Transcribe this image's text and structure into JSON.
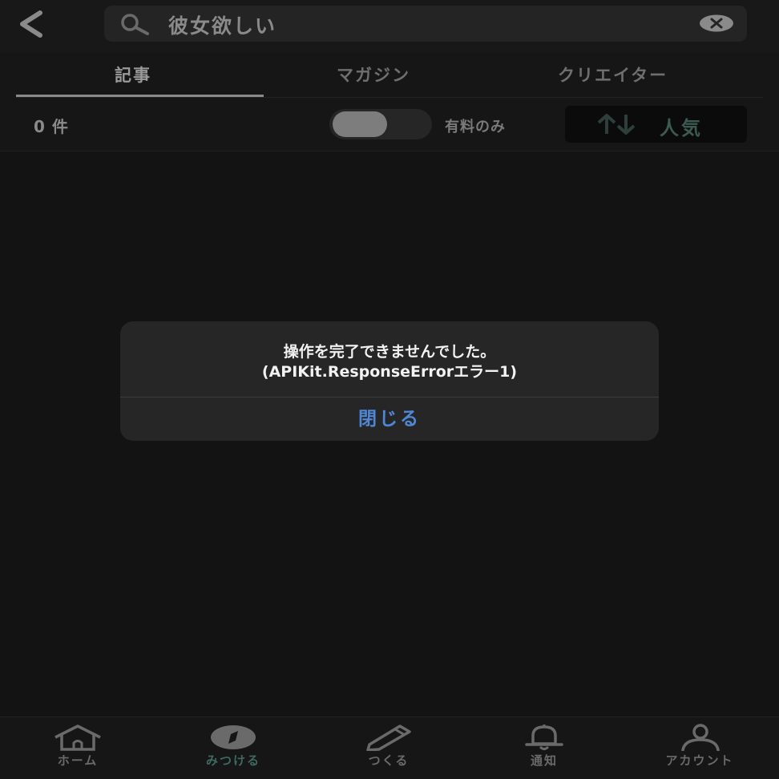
{
  "search": {
    "query": "彼女欲しい"
  },
  "tabs": [
    {
      "label": "記事",
      "active": true
    },
    {
      "label": "マガジン",
      "active": false
    },
    {
      "label": "クリエイター",
      "active": false
    }
  ],
  "filter": {
    "result_count": "0 件",
    "paid_only_label": "有料のみ",
    "paid_only_enabled": false,
    "sort_label": "人気"
  },
  "alert": {
    "line1": "操作を完了できませんでした。",
    "line2": "(APIKit.ResponseErrorエラー1)",
    "close_label": "閉じる"
  },
  "bottom_nav": [
    {
      "label": "ホーム",
      "icon": "home-icon",
      "active": false
    },
    {
      "label": "みつける",
      "icon": "compass-icon",
      "active": true
    },
    {
      "label": "つくる",
      "icon": "pencil-icon",
      "active": false
    },
    {
      "label": "通知",
      "icon": "bell-icon",
      "active": false
    },
    {
      "label": "アカウント",
      "icon": "person-icon",
      "active": false
    }
  ],
  "colors": {
    "background": "#131313",
    "accent_green": "#3e6a60",
    "alert_button_blue": "#4f86d6"
  }
}
